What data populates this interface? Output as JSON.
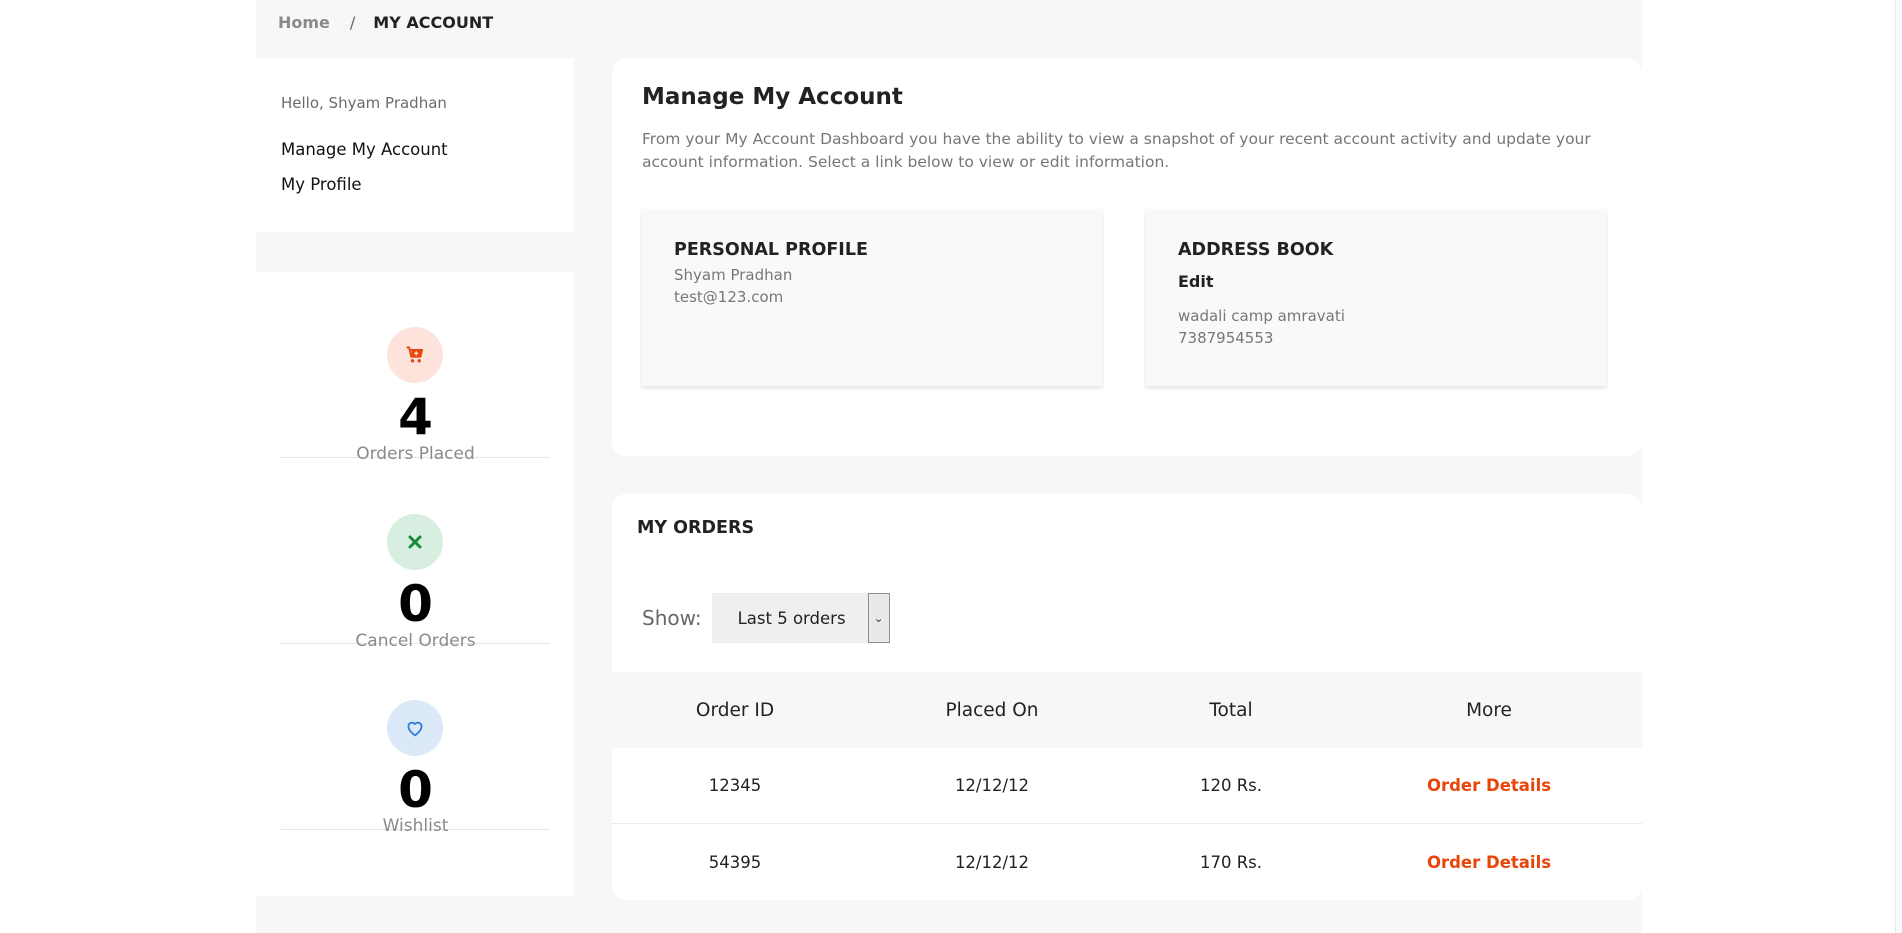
{
  "breadcrumb": {
    "home": "Home",
    "separator": "/",
    "current": "MY ACCOUNT"
  },
  "sidebar": {
    "greeting": "Hello, Shyam Pradhan",
    "items": [
      {
        "label": "Manage My Account"
      },
      {
        "label": "My Profile"
      }
    ]
  },
  "stats": [
    {
      "icon": "cart-icon",
      "value": "4",
      "label": "Orders Placed",
      "icon_color": "#e8450a",
      "icon_bg": "#fde3dc"
    },
    {
      "icon": "close-icon",
      "value": "0",
      "label": "Cancel Orders",
      "icon_color": "#1a8a3c",
      "icon_bg": "#d8eee0"
    },
    {
      "icon": "heart-icon",
      "value": "0",
      "label": "Wishlist",
      "icon_color": "#2f7fd6",
      "icon_bg": "#dce9f8"
    }
  ],
  "manage": {
    "title": "Manage My Account",
    "description": "From your My Account Dashboard you have the ability to view a snapshot of your recent account activity and update your account information. Select a link below to view or edit information.",
    "personal_profile": {
      "title": "PERSONAL PROFILE",
      "name": "Shyam Pradhan",
      "email": "test@123.com"
    },
    "address_book": {
      "title": "ADDRESS BOOK",
      "edit_label": "Edit",
      "address": "wadali camp amravati",
      "phone": "7387954553"
    }
  },
  "orders": {
    "title": "MY ORDERS",
    "show_label": "Show:",
    "selected_filter": "Last 5 orders",
    "columns": [
      "Order ID",
      "Placed On",
      "Total",
      "More"
    ],
    "rows": [
      {
        "id": "12345",
        "placed_on": "12/12/12",
        "total": "120 Rs.",
        "more": "Order Details"
      },
      {
        "id": "54395",
        "placed_on": "12/12/12",
        "total": "170 Rs.",
        "more": "Order Details"
      }
    ]
  },
  "colors": {
    "accent": "#e8450a",
    "background": "#f7f7f7"
  }
}
